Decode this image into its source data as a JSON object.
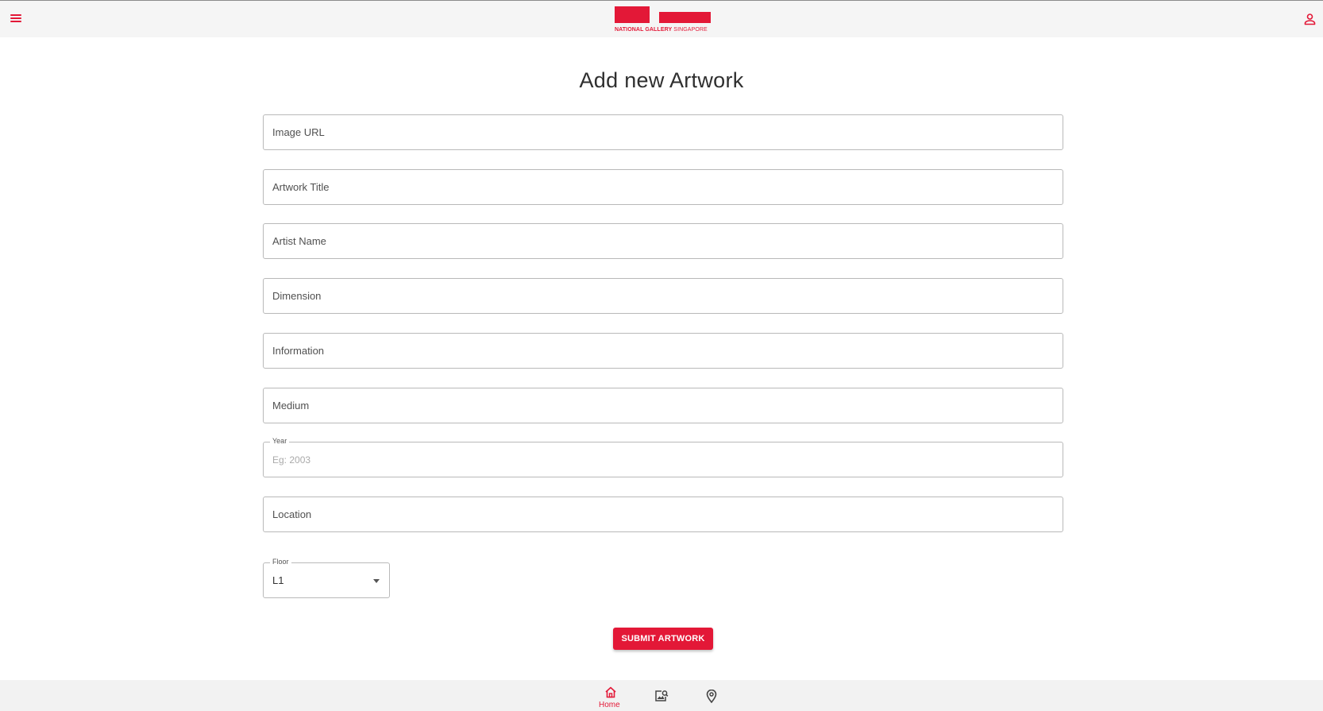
{
  "header": {
    "logo_text_bold": "NATIONAL GALLERY",
    "logo_text_light": " SINGAPORE",
    "menu_icon": "hamburger-menu-icon",
    "user_icon": "user-account-icon"
  },
  "form": {
    "title": "Add new Artwork",
    "fields": {
      "image_url": "Image URL",
      "artwork_title": "Artwork Title",
      "artist_name": "Artist Name",
      "dimension": "Dimension",
      "information": "Information",
      "medium": "Medium",
      "year_label": "Year",
      "year_placeholder": "Eg: 2003",
      "location": "Location"
    },
    "floor": {
      "label": "Floor",
      "selected": "L1"
    },
    "submit_label": "SUBMIT ARTWORK"
  },
  "bottom_nav": {
    "home_label": "Home",
    "items": [
      "home-icon",
      "gallery-search-icon",
      "map-pin-icon"
    ]
  },
  "colors": {
    "accent": "#e31837",
    "header_bg": "#f5f5f5",
    "border": "#b9b9b9"
  }
}
